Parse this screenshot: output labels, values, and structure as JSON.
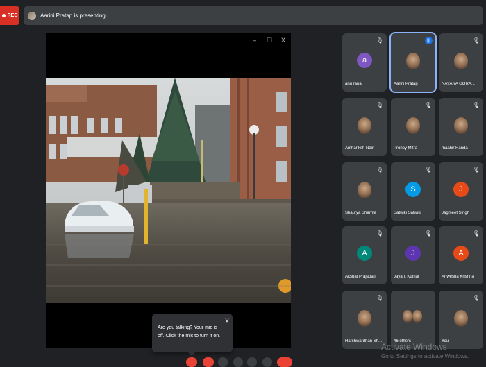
{
  "recording": {
    "label": "REC"
  },
  "presenting_banner": {
    "text": "Aarini Pratap is presenting"
  },
  "presentation_window": {
    "minimize": "–",
    "maximize": "☐",
    "close": "X"
  },
  "participants": [
    {
      "name": "anu rana",
      "initial": "a",
      "color": "#7e57c2",
      "type": "letter",
      "muted": true
    },
    {
      "name": "Aarini Pratap",
      "type": "photo",
      "muted": false,
      "speaking": true
    },
    {
      "name": "NAYANA GORA...",
      "type": "photo",
      "muted": true
    },
    {
      "name": "Anthariksh Nair",
      "type": "photo",
      "muted": true
    },
    {
      "name": "Pronoy Mitra",
      "type": "photo",
      "muted": true
    },
    {
      "name": "maahir Handa",
      "type": "photo",
      "muted": true
    },
    {
      "name": "Shaurya Sharma",
      "type": "photo",
      "muted": true
    },
    {
      "name": "Satwiki Satwiki",
      "initial": "S",
      "color": "#039be5",
      "type": "letter",
      "muted": true
    },
    {
      "name": "Jagmeet Singh",
      "initial": "J",
      "color": "#e64a19",
      "type": "letter",
      "muted": true
    },
    {
      "name": "Akshat Prajapati",
      "initial": "A",
      "color": "#00897b",
      "type": "letter",
      "muted": true
    },
    {
      "name": "Jayant Kumar",
      "initial": "J",
      "color": "#5e35b1",
      "type": "letter",
      "muted": true
    },
    {
      "name": "Anwesha Krishna",
      "initial": "A",
      "color": "#e64a19",
      "type": "letter",
      "muted": true
    },
    {
      "name": "Harshwardhan Sh...",
      "type": "photo",
      "muted": true
    },
    {
      "name": "46 others",
      "type": "group",
      "muted": false
    },
    {
      "name": "You",
      "type": "photo",
      "muted": true
    }
  ],
  "toast": {
    "message": "Are you talking? Your mic is off. Click the mic to turn it on.",
    "close": "X"
  },
  "watermark": {
    "title": "Activate Windows",
    "subtitle": "Go to Settings to activate Windows."
  },
  "icons": {
    "mic_off": "🎙",
    "speaking": "|||"
  }
}
